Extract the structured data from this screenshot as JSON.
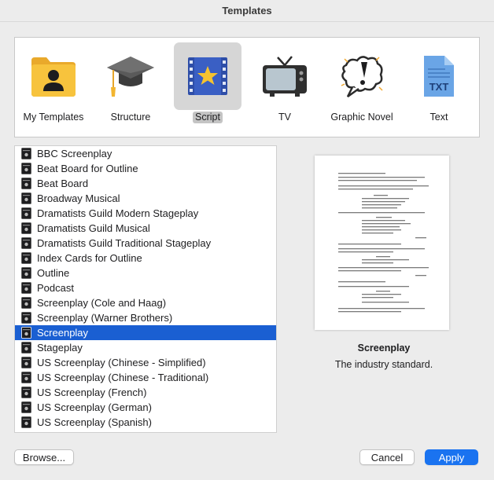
{
  "window": {
    "title": "Templates"
  },
  "categories": [
    {
      "label": "My Templates",
      "icon": "folder-person-icon",
      "selected": false
    },
    {
      "label": "Structure",
      "icon": "graduation-cap-icon",
      "selected": false
    },
    {
      "label": "Script",
      "icon": "film-strip-star-icon",
      "selected": true
    },
    {
      "label": "TV",
      "icon": "television-icon",
      "selected": false
    },
    {
      "label": "Graphic Novel",
      "icon": "speech-bubble-exclamation-icon",
      "selected": false
    },
    {
      "label": "Text",
      "icon": "txt-file-icon",
      "selected": false
    }
  ],
  "templates": {
    "items": [
      "BBC Screenplay",
      "Beat Board for Outline",
      "Beat Board",
      "Broadway Musical",
      "Dramatists Guild Modern Stageplay",
      "Dramatists Guild Musical",
      "Dramatists Guild Traditional Stageplay",
      "Index Cards for Outline",
      "Outline",
      "Podcast",
      "Screenplay (Cole and Haag)",
      "Screenplay (Warner Brothers)",
      "Screenplay",
      "Stageplay",
      "US Screenplay (Chinese - Simplified)",
      "US Screenplay (Chinese - Traditional)",
      "US Screenplay (French)",
      "US Screenplay (German)",
      "US Screenplay (Spanish)"
    ],
    "selected": "Screenplay",
    "item_icon": "script-document-icon"
  },
  "preview": {
    "title": "Screenplay",
    "description": "The industry standard."
  },
  "buttons": {
    "browse": "Browse...",
    "cancel": "Cancel",
    "apply": "Apply"
  },
  "colors": {
    "selection": "#1a5fd2",
    "primary_button": "#1a73f0",
    "folder": "#f6c33b",
    "film": "#2e4ea8",
    "star": "#f5c330",
    "txt": "#6aa5e6"
  }
}
